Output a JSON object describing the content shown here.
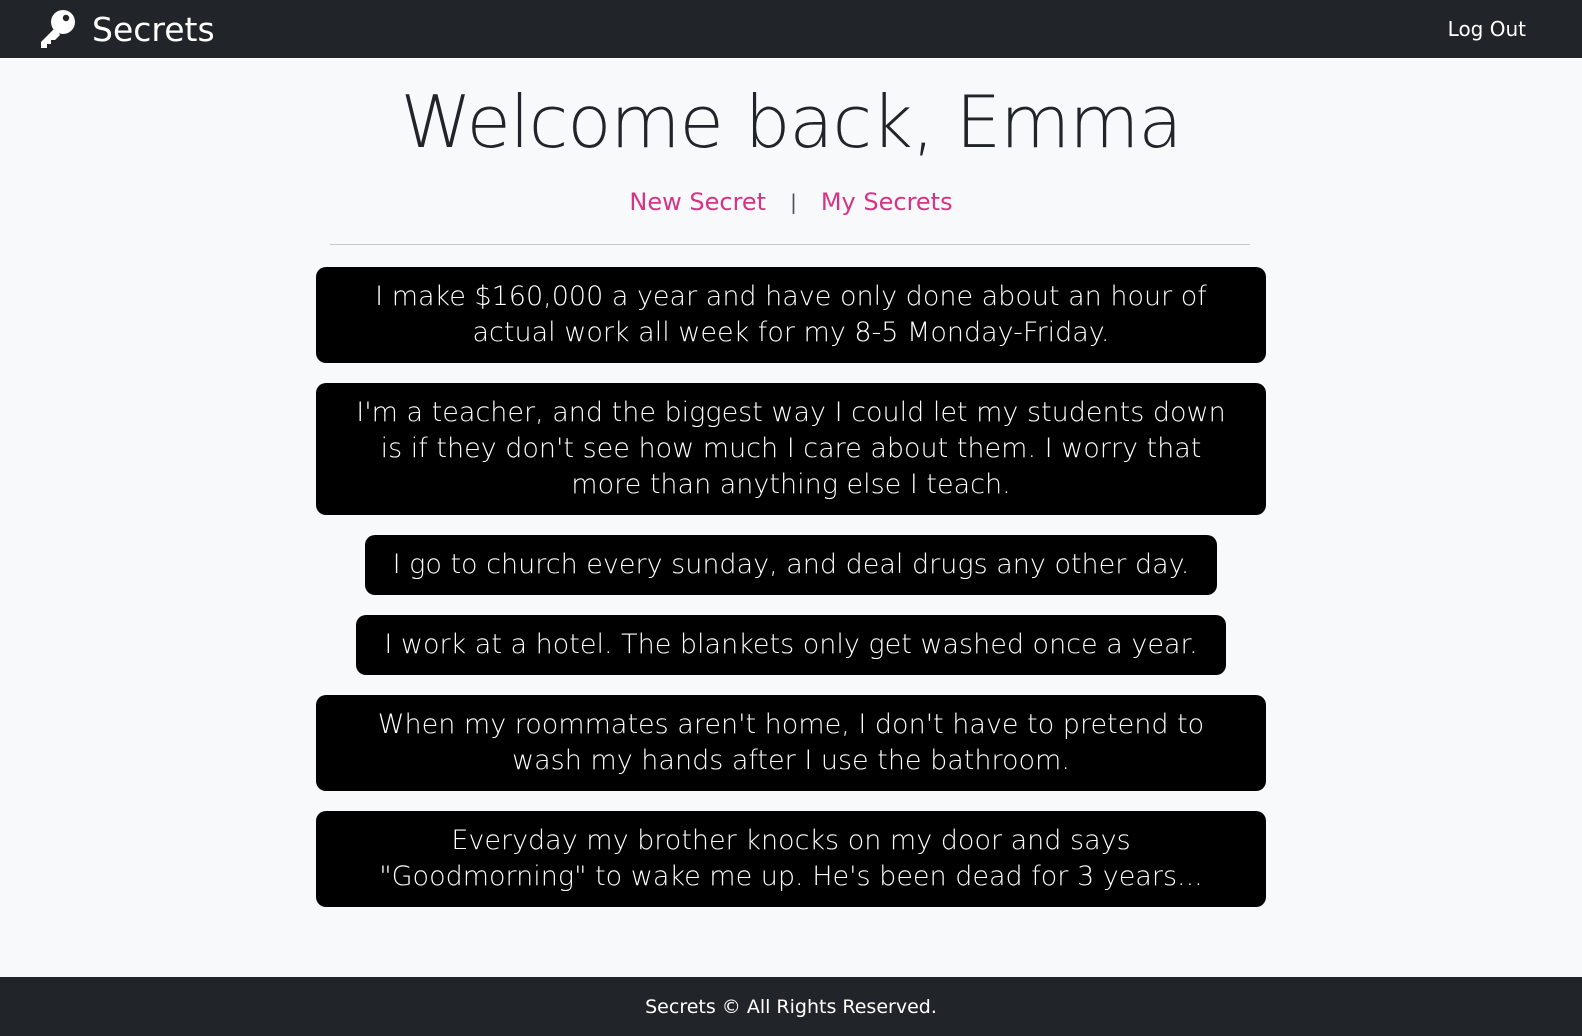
{
  "navbar": {
    "brand_icon": "key-icon",
    "brand_label": "Secrets",
    "logout_label": "Log Out"
  },
  "main": {
    "welcome": "Welcome back, Emma",
    "links": {
      "new_secret": "New Secret",
      "separator": "|",
      "my_secrets": "My Secrets"
    },
    "link_color": "#d63384",
    "secrets": [
      "I make $160,000 a year and have only done about an hour of actual work all week for my 8-5 Monday-Friday.",
      "I'm a teacher, and the biggest way I could let my students down is if they don't see how much I care about them. I worry that more than anything else I teach.",
      "I go to church every sunday, and deal drugs any other day.",
      "I work at a hotel. The blankets only get washed once a year.",
      "When my roommates aren't home, I don't have to pretend to wash my hands after I use the bathroom.",
      "Everyday my brother knocks on my door and says \"Goodmorning\" to wake me up. He's been dead for 3 years..."
    ]
  },
  "footer": {
    "text": "Secrets © All Rights Reserved."
  }
}
